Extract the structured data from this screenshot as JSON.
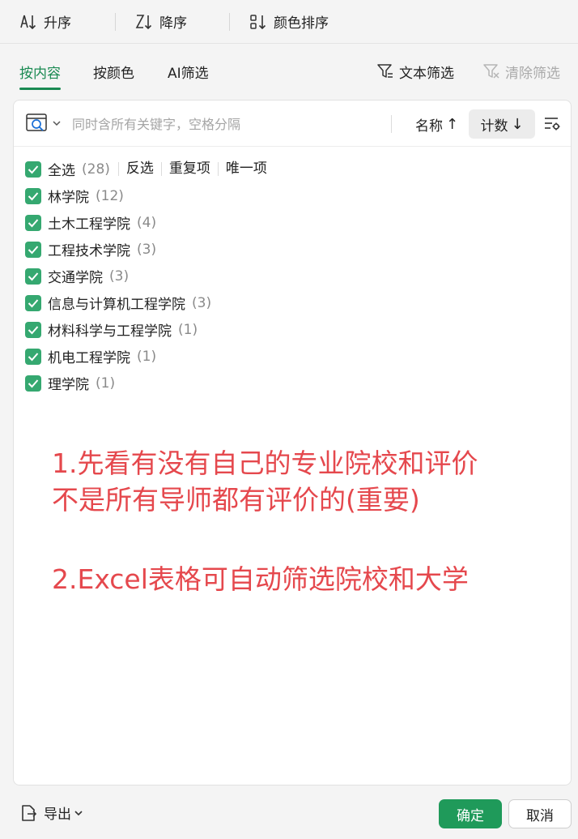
{
  "sort_bar": {
    "ascending_label": "升序",
    "descending_label": "降序",
    "color_sort_label": "颜色排序"
  },
  "tabs": [
    {
      "label": "按内容",
      "active": true
    },
    {
      "label": "按颜色",
      "active": false
    },
    {
      "label": "AI筛选",
      "active": false
    }
  ],
  "text_filter_label": "文本筛选",
  "clear_filter_label": "清除筛选",
  "search": {
    "placeholder": "同时含所有关键字，空格分隔",
    "value": ""
  },
  "sort_options": {
    "name_label": "名称",
    "name_arrow": "↑",
    "count_label": "计数",
    "count_arrow": "↓"
  },
  "select_all": {
    "label": "全选",
    "count": "(28)",
    "actions": [
      "反选",
      "重复项",
      "唯一项"
    ]
  },
  "items": [
    {
      "label": "林学院",
      "count": "(12)",
      "checked": true
    },
    {
      "label": "土木工程学院",
      "count": "(4)",
      "checked": true
    },
    {
      "label": "工程技术学院",
      "count": "(3)",
      "checked": true
    },
    {
      "label": "交通学院",
      "count": "(3)",
      "checked": true
    },
    {
      "label": "信息与计算机工程学院",
      "count": "(3)",
      "checked": true
    },
    {
      "label": "材料科学与工程学院",
      "count": "(1)",
      "checked": true
    },
    {
      "label": "机电工程学院",
      "count": "(1)",
      "checked": true
    },
    {
      "label": "理学院",
      "count": "(1)",
      "checked": true
    }
  ],
  "annotations": {
    "line1": "1.先看有没有自己的专业院校和评价",
    "line2": "不是所有导师都有评价的(重要)",
    "line3": "2.Excel表格可自动筛选院校和大学"
  },
  "footer": {
    "export_label": "导出",
    "ok_label": "确定",
    "cancel_label": "取消"
  },
  "colors": {
    "accent": "#1a8a52",
    "checkbox": "#35a870",
    "ok_button": "#1f9a5a",
    "annotation": "#e5484d"
  }
}
